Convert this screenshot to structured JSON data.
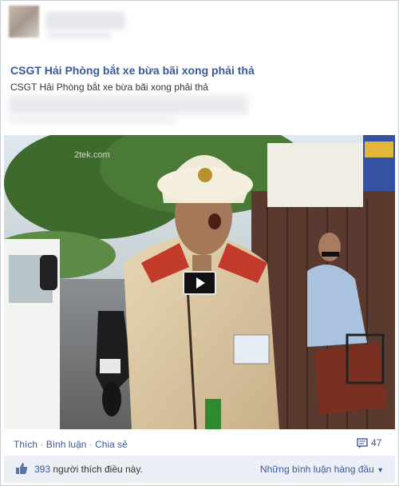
{
  "post": {
    "title": "CSGT Hải Phòng bắt xe bừa bãi xong phải thả",
    "subtitle": "CSGT Hải Phòng bắt xe bừa bãi xong phải thả"
  },
  "video": {
    "watermark": "2tek.com"
  },
  "actions": {
    "like": "Thích",
    "comment": "Bình luận",
    "share": "Chia sẻ",
    "separator": "·",
    "comment_count": "47"
  },
  "likes": {
    "count": "393",
    "text": "người thích điều này.",
    "sort_label": "Những bình luận hàng đầu"
  },
  "colors": {
    "link": "#3b5998",
    "likes_bg": "#eceff5"
  }
}
